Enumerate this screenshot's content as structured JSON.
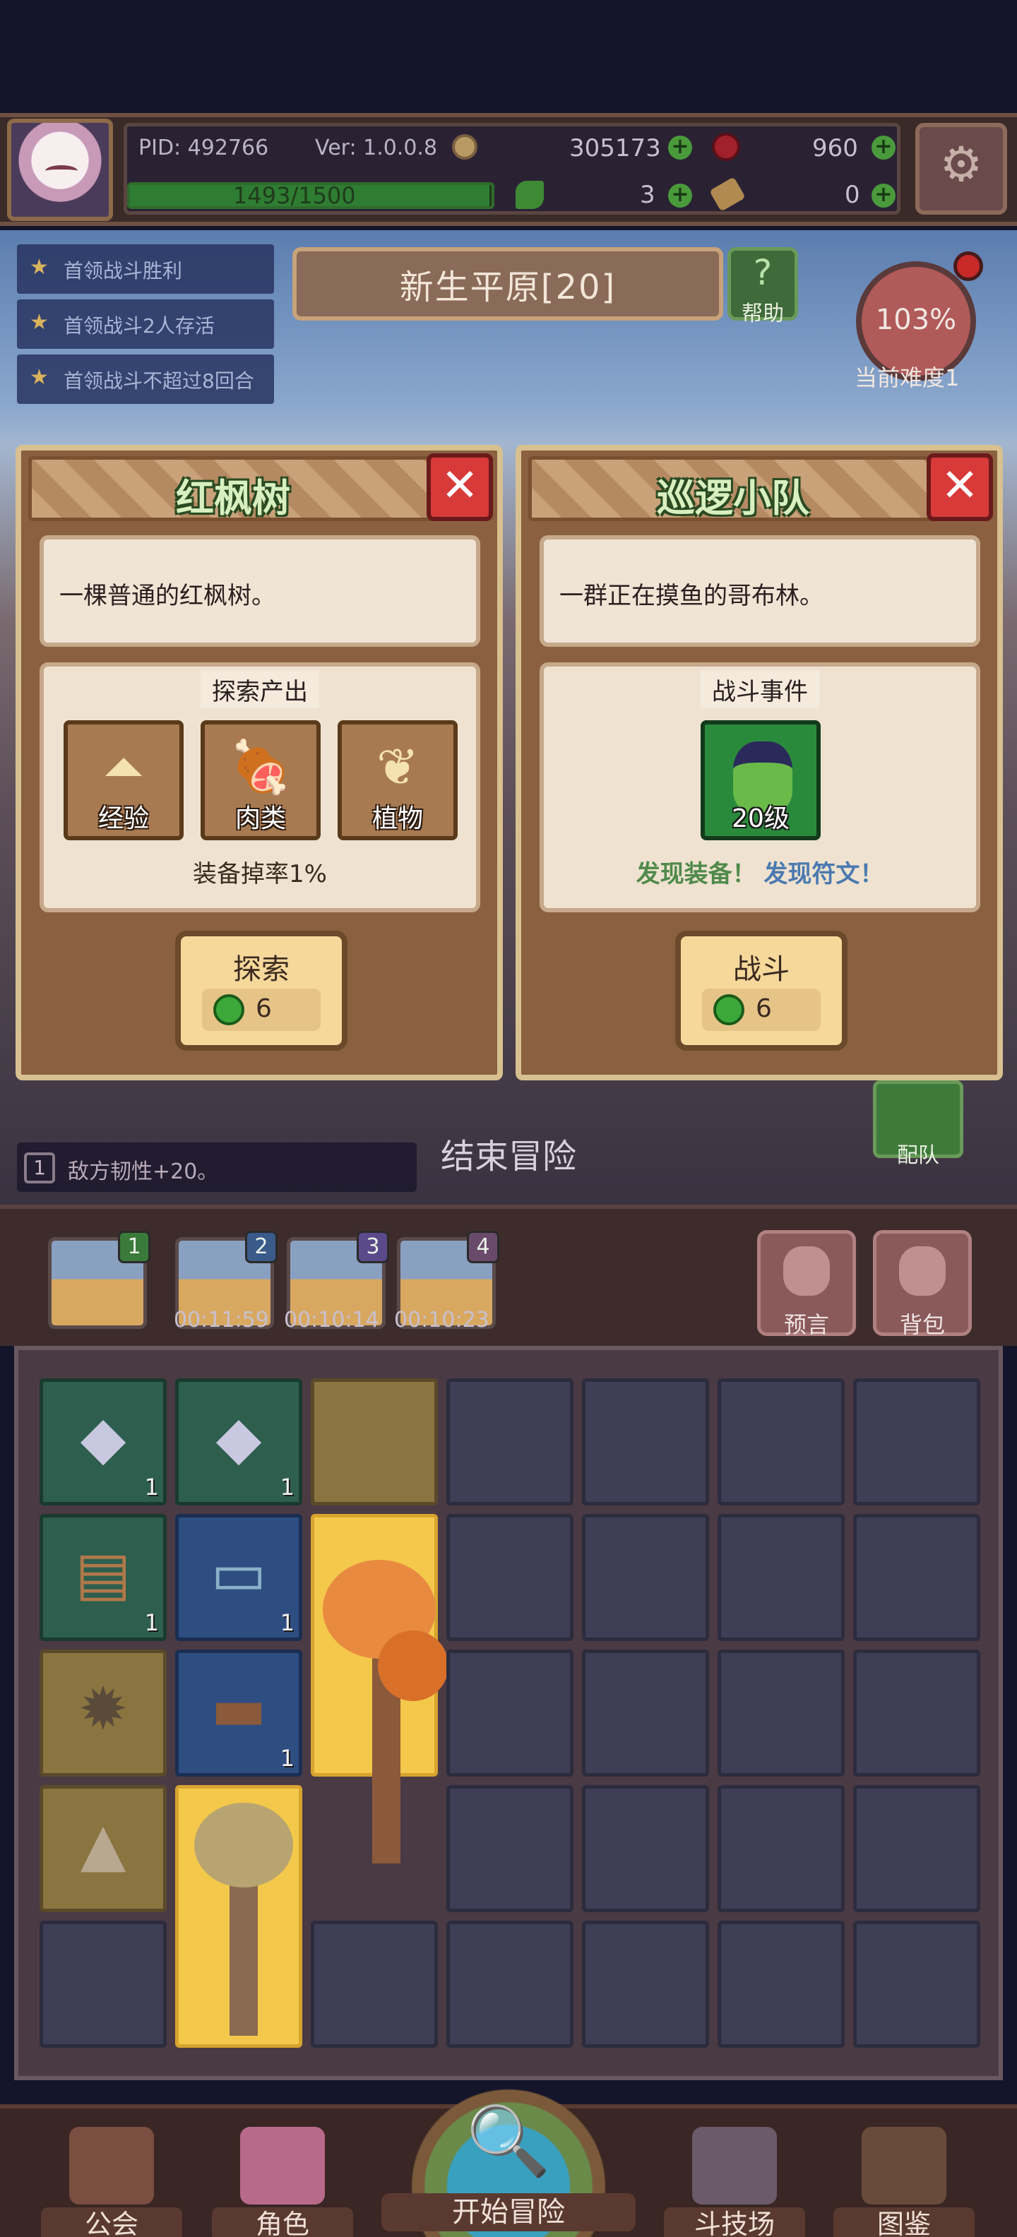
{
  "header": {
    "pid": "PID: 492766",
    "version": "Ver: 1.0.0.8",
    "coins": "305173",
    "rubies": "960",
    "xp_text": "1493/1500",
    "xp_progress": 0.995,
    "clover": "3",
    "keys": "0"
  },
  "quests": [
    "首领战斗胜利",
    "首领战斗2人存活",
    "首领战斗不超过8回合"
  ],
  "map": {
    "title": "新生平原[20]",
    "help_label": "帮助",
    "difficulty_pct": "103%",
    "difficulty_label": "当前难度1"
  },
  "card_left": {
    "title": "红枫树",
    "description": "一棵普通的红枫树。",
    "section": "探索产出",
    "outputs": [
      "经验",
      "肉类",
      "植物"
    ],
    "drop_rate": "装备掉率1%",
    "action": "探索",
    "cost": "6"
  },
  "card_right": {
    "title": "巡逻小队",
    "description": "一群正在摸鱼的哥布林。",
    "section": "战斗事件",
    "enemy_level": "20级",
    "discover_equip": "发现装备！",
    "discover_rune": "发现符文！",
    "action": "战斗",
    "cost": "6"
  },
  "mid": {
    "team_label": "配队",
    "end_label": "结束冒险",
    "buff_num": "1",
    "buff_text": "敌方韧性+20。"
  },
  "tray": {
    "badges": [
      "1",
      "2",
      "3",
      "4"
    ],
    "timers": [
      "00:11:59",
      "00:10:14",
      "00:10:23"
    ],
    "prophecy": "预言",
    "backpack": "背包"
  },
  "inventory": {
    "qty": [
      "1",
      "1",
      "1",
      "1",
      "1"
    ]
  },
  "nav": {
    "guild": "公会",
    "character": "角色",
    "start": "开始冒险",
    "arena": "斗技场",
    "codex": "图鉴"
  },
  "colors": {
    "accent_green": "#2e7d32",
    "close_red": "#d83a3a",
    "discover_equip": "#4f8a4a",
    "discover_rune": "#4a7ab0"
  }
}
